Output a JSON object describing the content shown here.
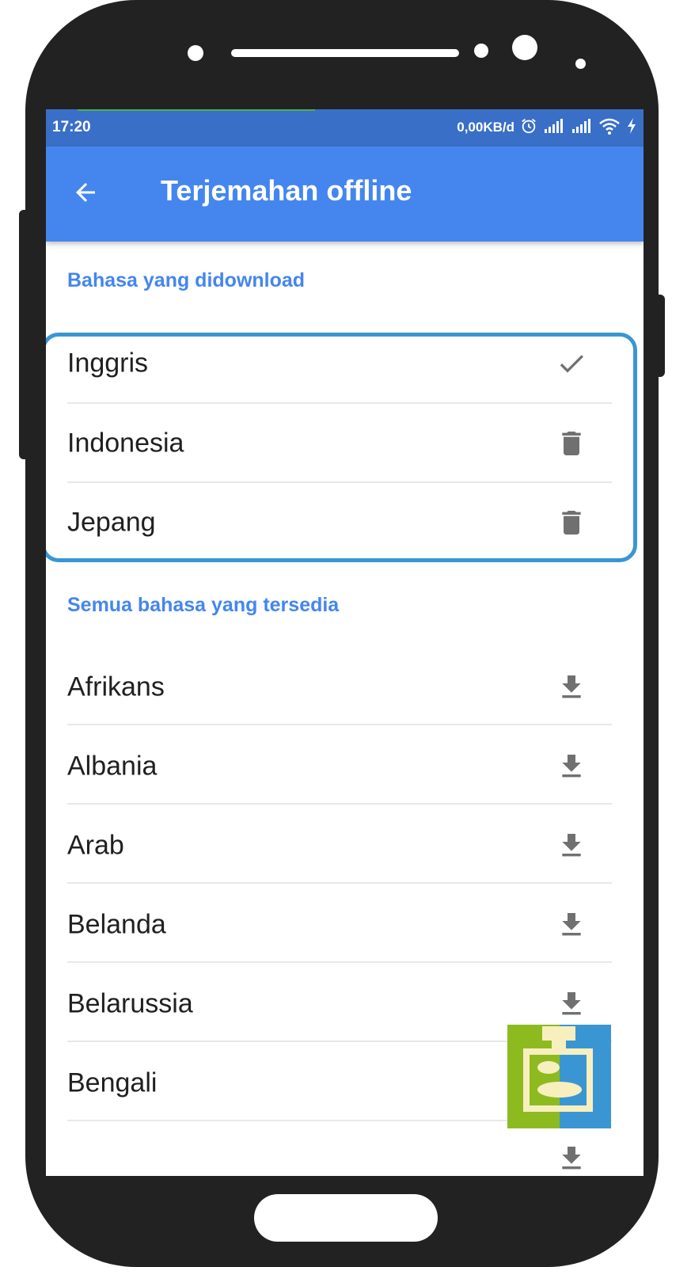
{
  "status_bar": {
    "time": "17:20",
    "net_speed": "0,00KB/d"
  },
  "app_bar": {
    "title": "Terjemahan offline",
    "back_icon": "arrow-left-icon"
  },
  "downloaded_section": {
    "header": "Bahasa yang didownload",
    "items": [
      {
        "label": "Inggris",
        "icon": "check-icon"
      },
      {
        "label": "Indonesia",
        "icon": "trash-icon"
      },
      {
        "label": "Jepang",
        "icon": "trash-icon"
      }
    ]
  },
  "available_section": {
    "header": "Semua bahasa yang tersedia",
    "items": [
      {
        "label": "Afrikans",
        "icon": "download-icon"
      },
      {
        "label": "Albania",
        "icon": "download-icon"
      },
      {
        "label": "Arab",
        "icon": "download-icon"
      },
      {
        "label": "Belanda",
        "icon": "download-icon"
      },
      {
        "label": "Belarussia",
        "icon": "download-icon"
      },
      {
        "label": "Bengali",
        "icon": "download-icon"
      }
    ]
  },
  "colors": {
    "status_bar": "#3a6fc8",
    "app_bar": "#4486ee",
    "section_header": "#4486ee",
    "highlight": "#3a96d3",
    "icon": "#707070"
  }
}
